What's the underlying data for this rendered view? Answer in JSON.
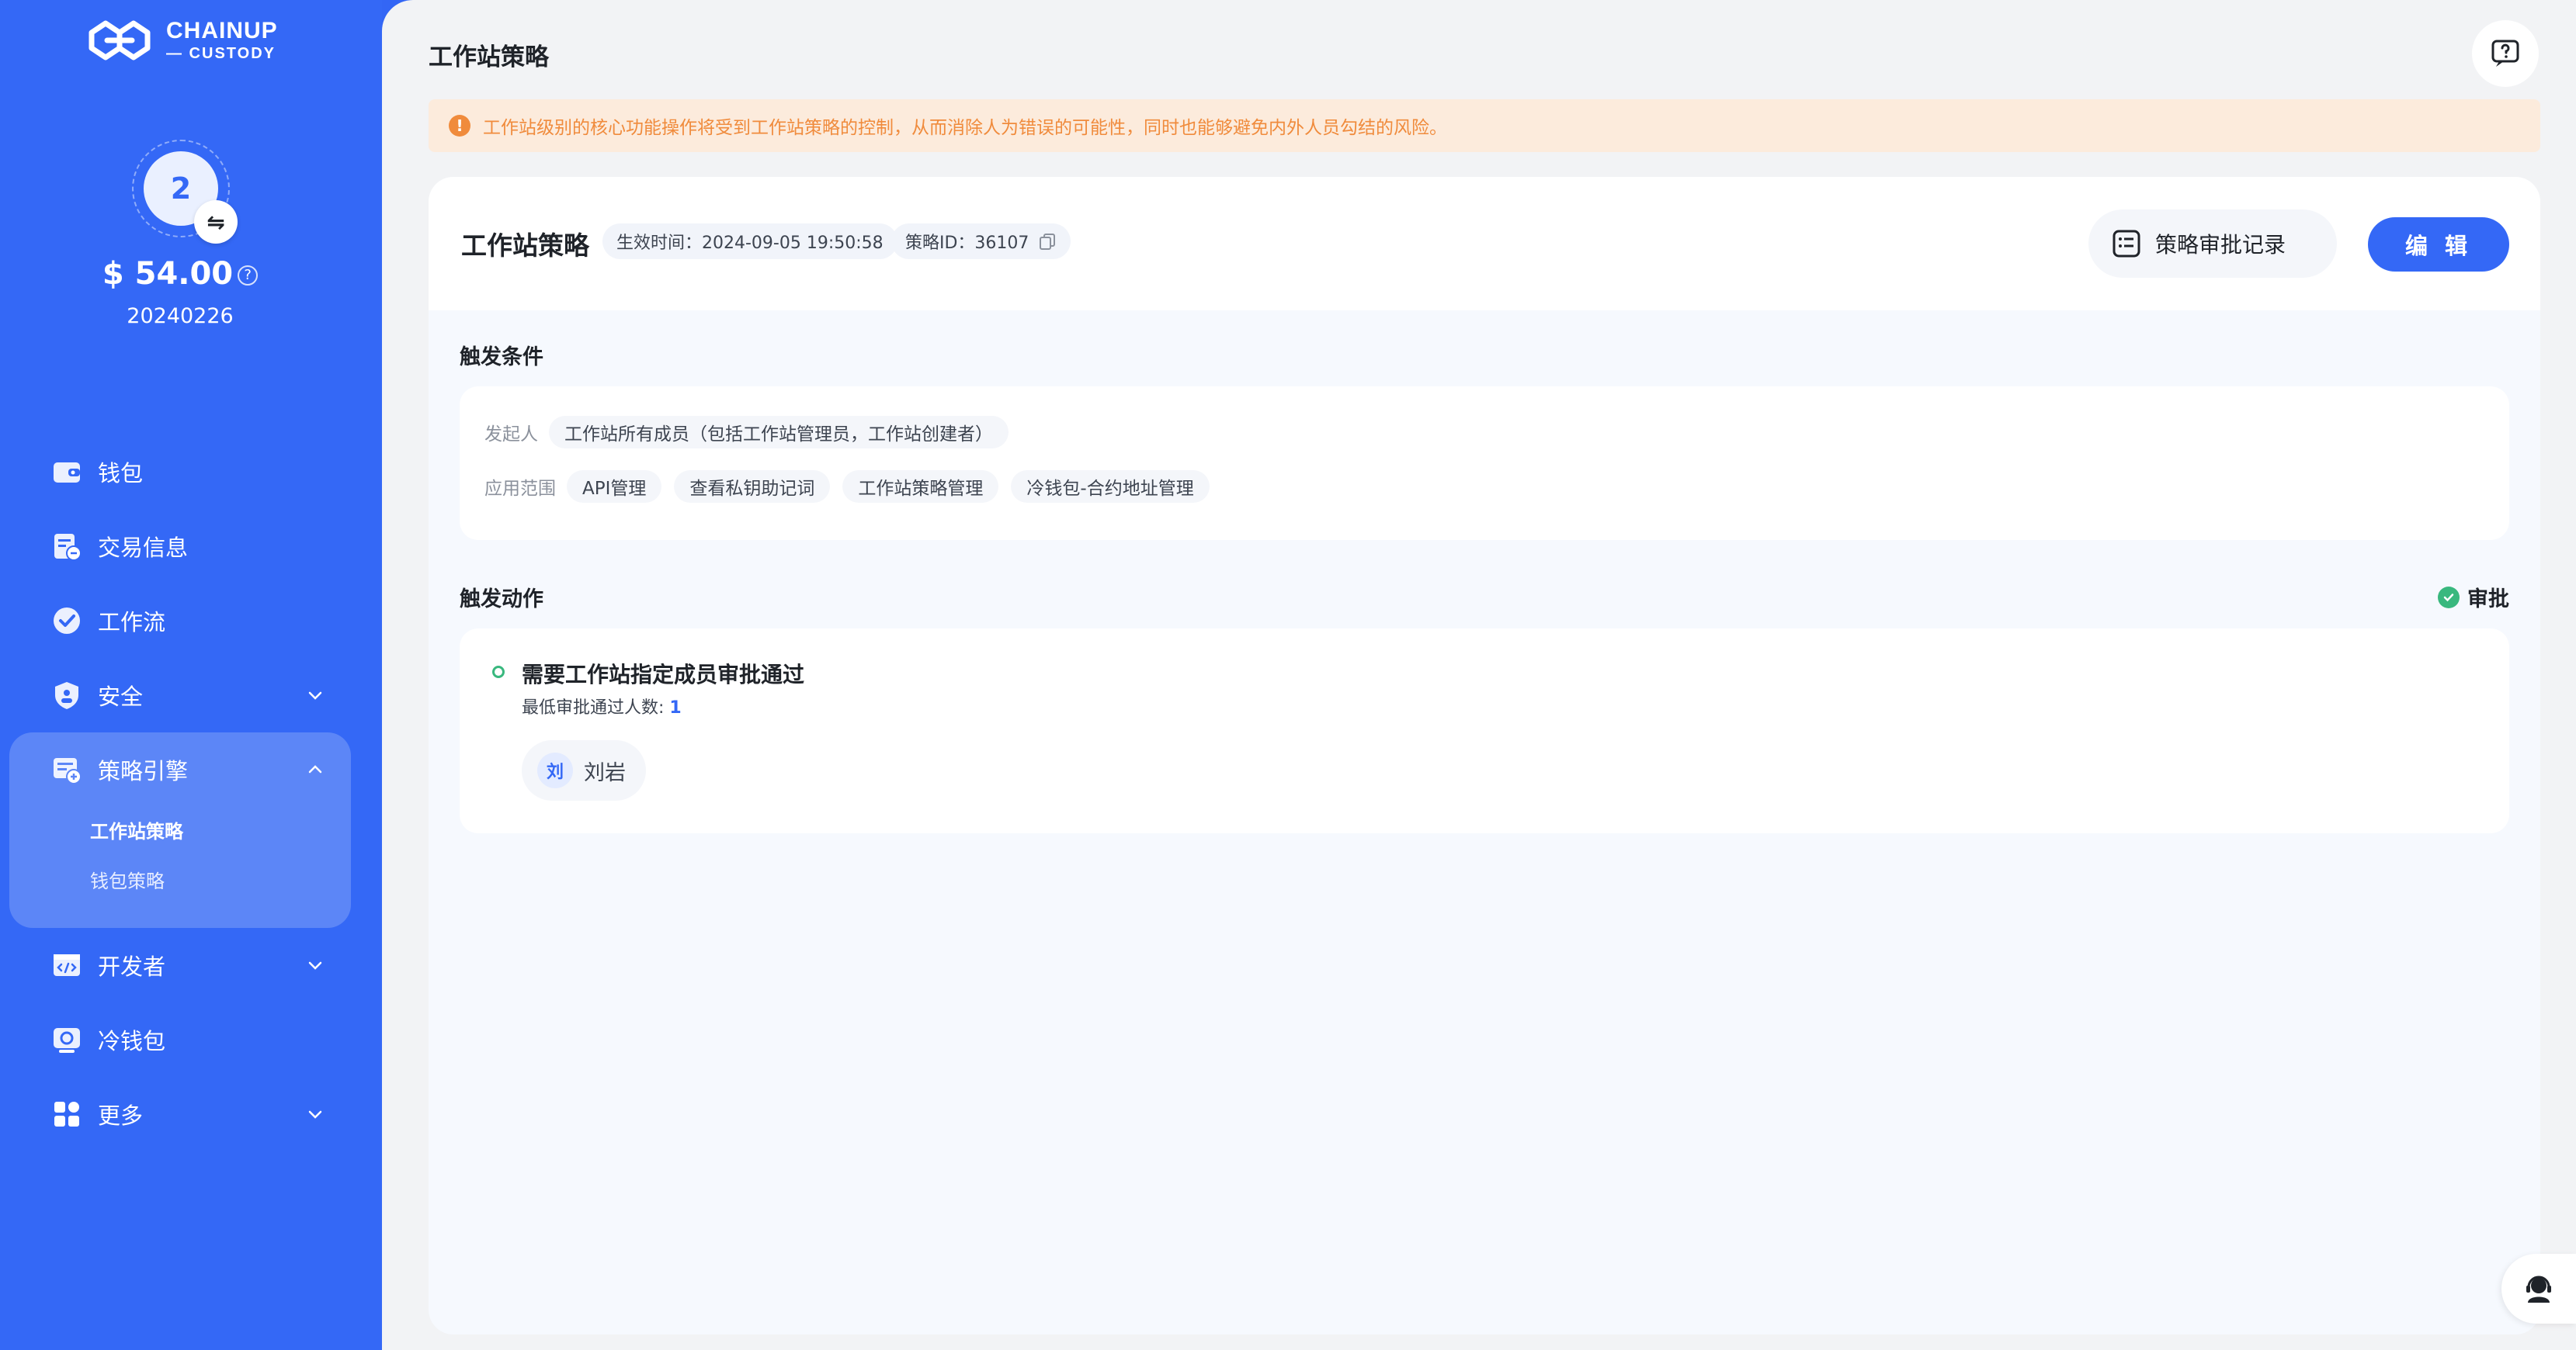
{
  "sidebar": {
    "logo": {
      "line1": "CHAINUP",
      "line2": "— CUSTODY"
    },
    "workspace_number": "2",
    "swap_icon": "⇋",
    "balance": "$ 54.00",
    "account_id": "20240226",
    "items": [
      {
        "label": "钱包",
        "icon": "wallet-icon"
      },
      {
        "label": "交易信息",
        "icon": "transaction-icon"
      },
      {
        "label": "工作流",
        "icon": "workflow-icon"
      },
      {
        "label": "安全",
        "icon": "shield-icon"
      },
      {
        "label": "策略引擎",
        "icon": "strategy-icon"
      },
      {
        "label": "开发者",
        "icon": "developer-icon"
      },
      {
        "label": "冷钱包",
        "icon": "cold-wallet-icon"
      },
      {
        "label": "更多",
        "icon": "more-icon"
      }
    ],
    "strategy_subitems": [
      {
        "label": "工作站策略",
        "active": true
      },
      {
        "label": "钱包策略",
        "active": false
      }
    ]
  },
  "header": {
    "title": "工作站策略"
  },
  "notice": {
    "text": "工作站级别的核心功能操作将受到工作站策略的控制，从而消除人为错误的可能性，同时也能够避免内外人员勾结的风险。"
  },
  "policy": {
    "title": "工作站策略",
    "effective_time": "生效时间：2024-09-05 19:50:58",
    "policy_id": "策略ID：36107",
    "audit_button": "策略审批记录",
    "edit_button": "编 辑"
  },
  "trigger_conditions": {
    "label": "触发条件",
    "initiator_key": "发起人",
    "initiator_value": "工作站所有成员（包括工作站管理员，工作站创建者）",
    "scope_key": "应用范围",
    "scope_tags": [
      "API管理",
      "查看私钥助记词",
      "工作站策略管理",
      "冷钱包-合约地址管理"
    ]
  },
  "trigger_actions": {
    "label": "触发动作",
    "flag": "审批",
    "step_title": "需要工作站指定成员审批通过",
    "min_approvers_label": "最低审批通过人数: ",
    "min_approvers_value": "1",
    "member_initial": "刘",
    "member_name": "刘岩"
  },
  "colors": {
    "brand": "#3468f6",
    "notice_bg": "#fcebdc",
    "notice_text": "#f08b3c",
    "success": "#39b87e"
  }
}
